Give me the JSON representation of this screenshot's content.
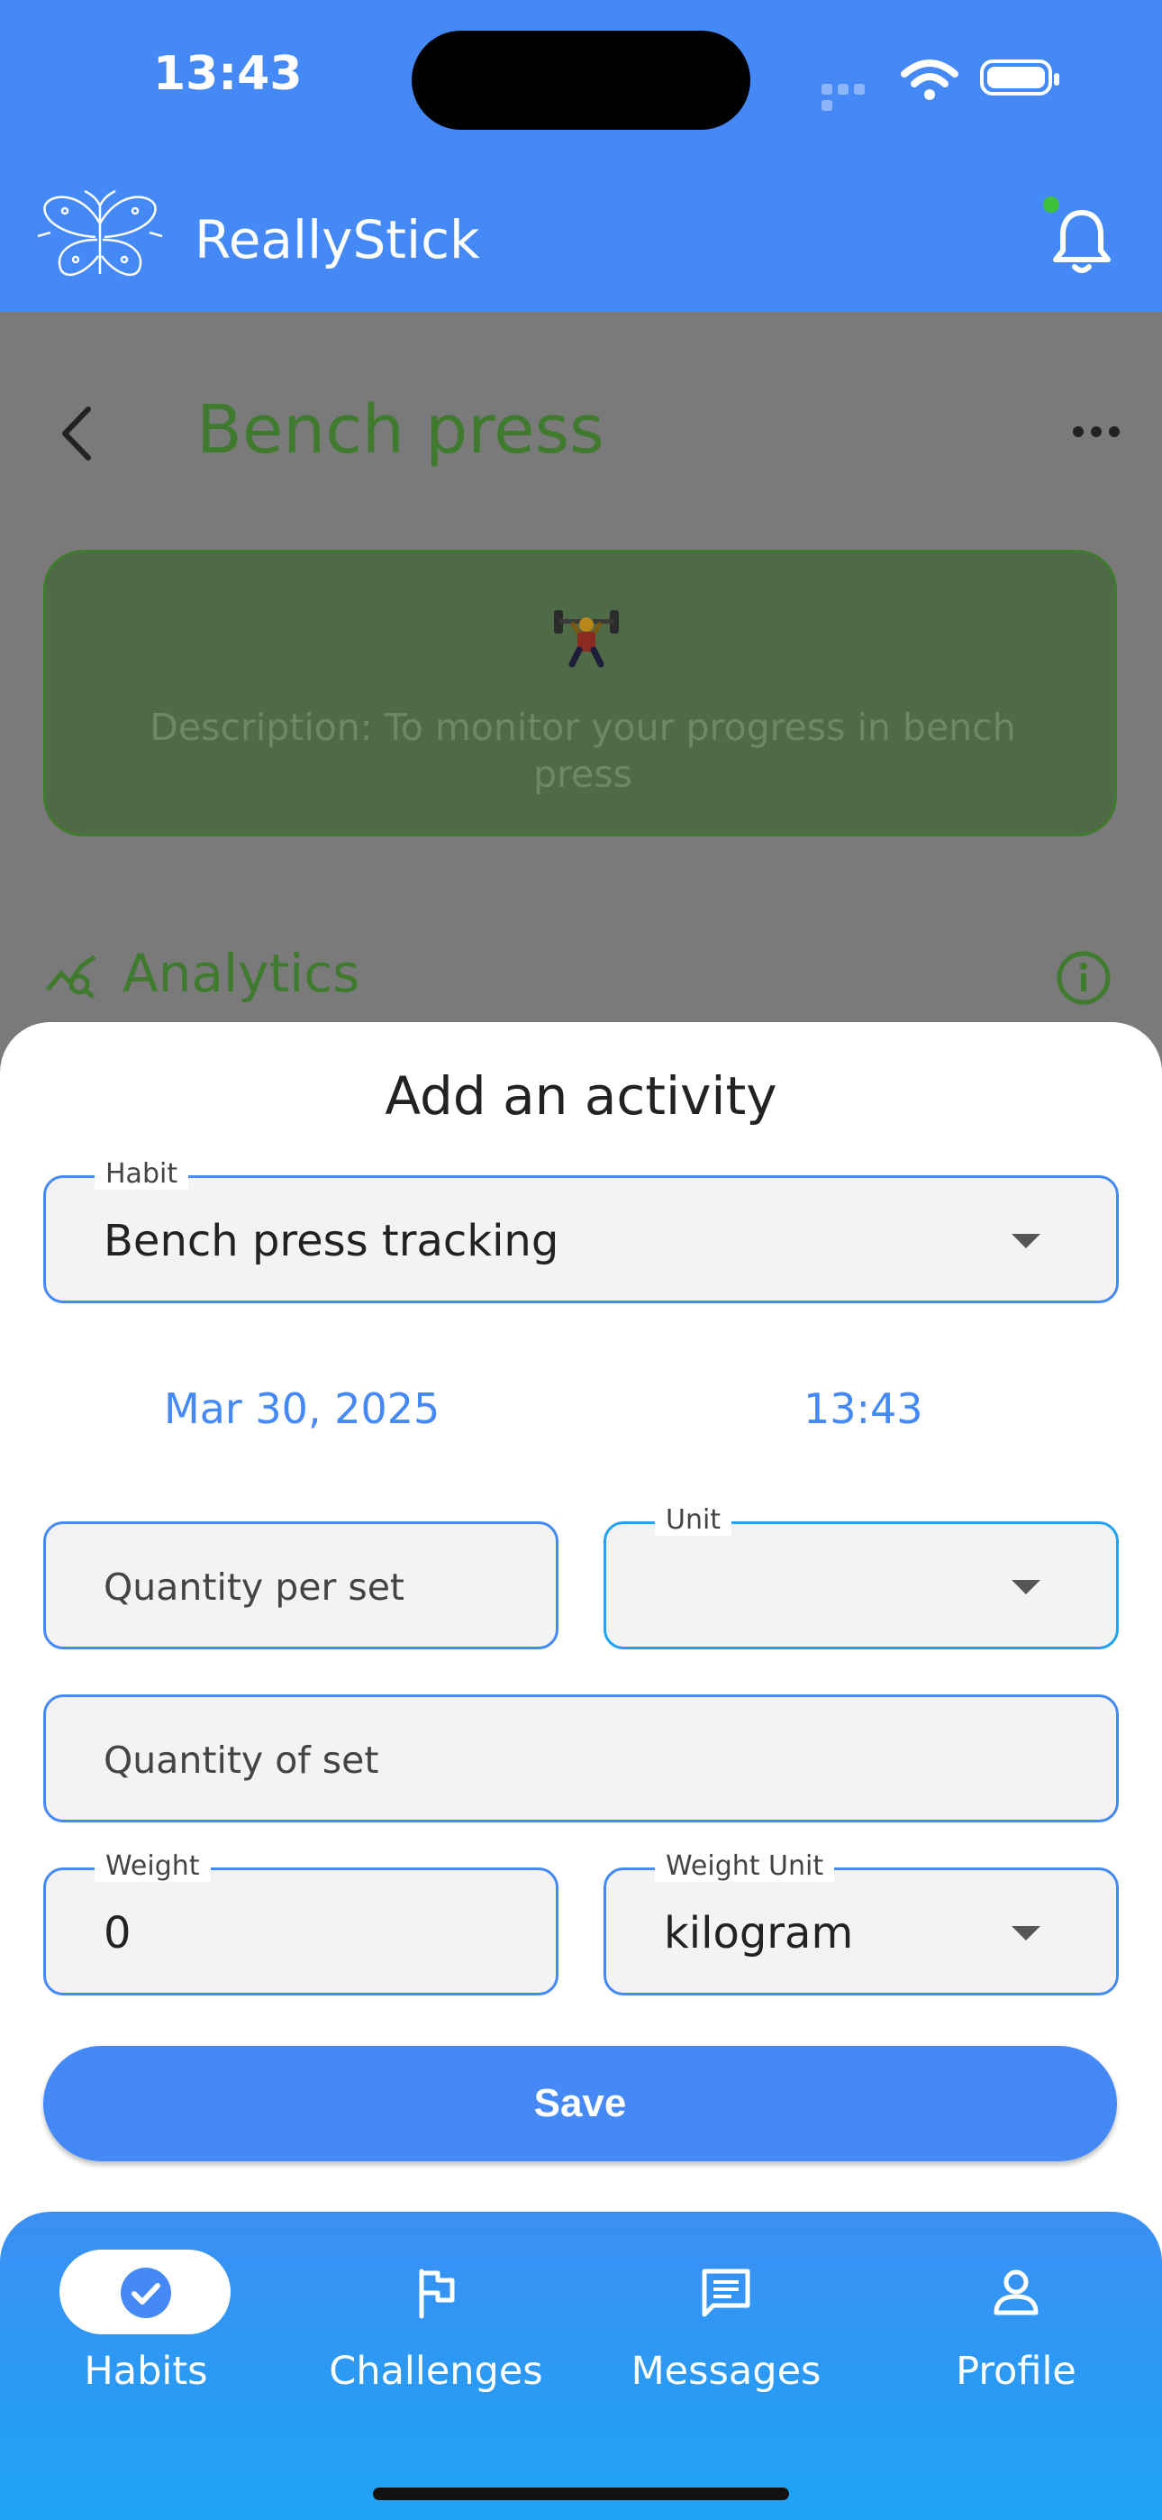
{
  "status_bar": {
    "time": "13:43"
  },
  "app_bar": {
    "title": "ReallyStick",
    "icons": [
      "butterfly-logo-icon",
      "bell-icon"
    ],
    "notification_dot_color": "#3ec23e"
  },
  "page": {
    "title": "Bench press",
    "card": {
      "emoji": "weightlifter",
      "description": "Description: To monitor your progress in bench press"
    },
    "analytics_label": "Analytics"
  },
  "sheet": {
    "title": "Add an activity",
    "habit": {
      "label": "Habit",
      "value": "Bench press tracking"
    },
    "date": "Mar 30, 2025",
    "time": "13:43",
    "quantity_per_set": {
      "placeholder": "Quantity per set"
    },
    "unit": {
      "label": "Unit",
      "value": ""
    },
    "quantity_of_set": {
      "placeholder": "Quantity of set"
    },
    "weight": {
      "label": "Weight",
      "value": "0"
    },
    "weight_unit": {
      "label": "Weight Unit",
      "value": "kilogram"
    },
    "save_label": "Save"
  },
  "nav": {
    "items": [
      {
        "label": "Habits",
        "icon": "check-circle-icon",
        "active": true
      },
      {
        "label": "Challenges",
        "icon": "flag-icon",
        "active": false
      },
      {
        "label": "Messages",
        "icon": "message-icon",
        "active": false
      },
      {
        "label": "Profile",
        "icon": "person-icon",
        "active": false
      }
    ]
  },
  "colors": {
    "primary": "#4589f7",
    "green": "#3f7a2f",
    "scrim": "#7a7a7a"
  }
}
